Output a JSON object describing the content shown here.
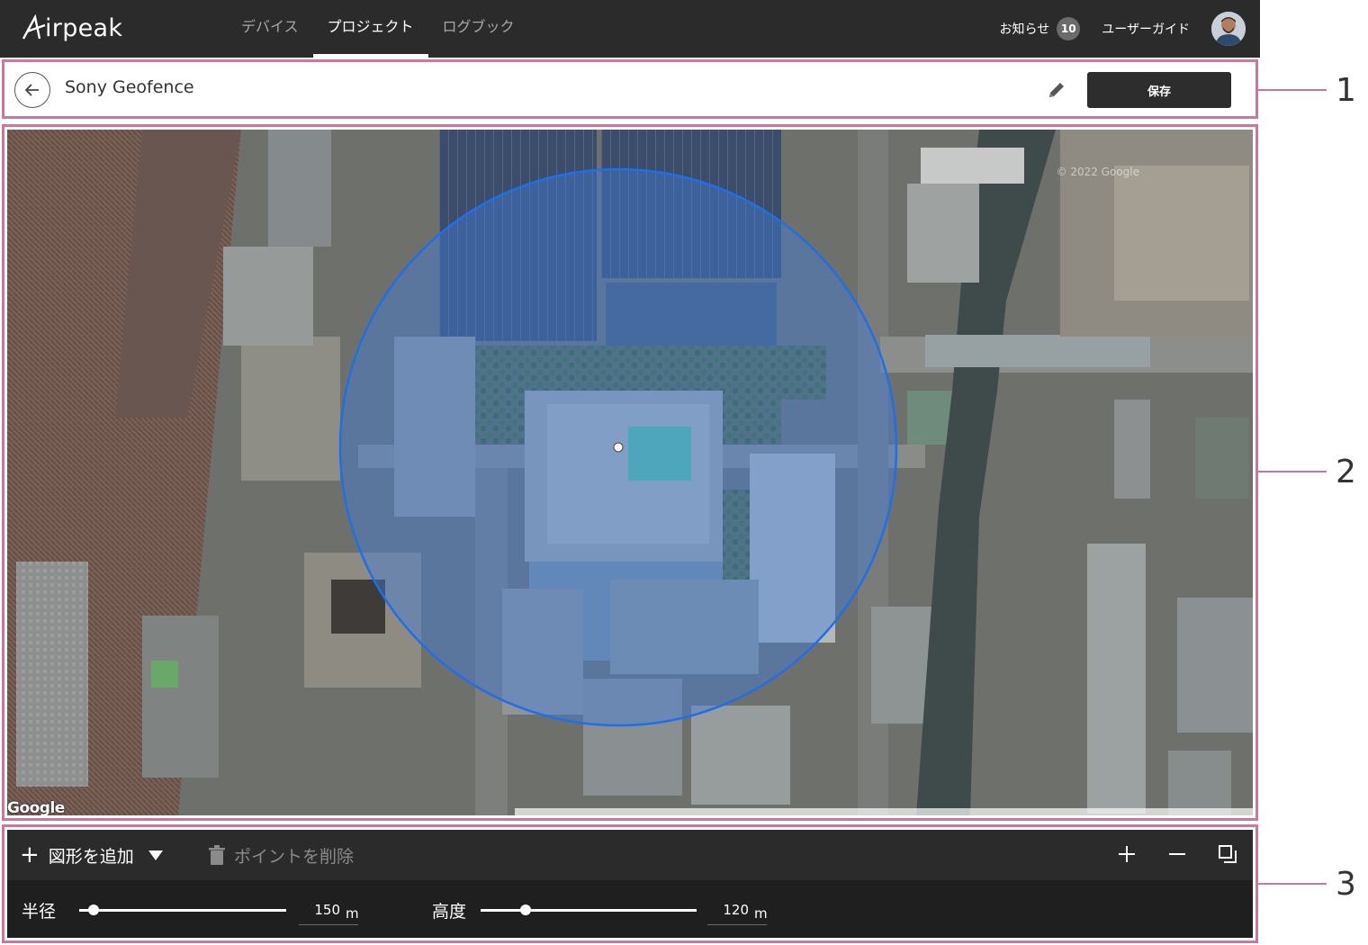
{
  "app": {
    "logo_text": "irpeak",
    "nav_tabs": [
      {
        "label": "デバイス",
        "active": false
      },
      {
        "label": "プロジェクト",
        "active": true
      },
      {
        "label": "ログブック",
        "active": false
      }
    ],
    "news_label": "お知らせ",
    "news_count": "10",
    "guide_label": "ユーザーガイド"
  },
  "header": {
    "title": "Sony Geofence",
    "save_label": "保存"
  },
  "map": {
    "provider_logo": "Google",
    "copyright": "© 2022 Google",
    "geofence": {
      "shape": "circle",
      "fill": "#3d7fe0",
      "stroke": "#1e6fe8"
    }
  },
  "toolbar": {
    "add_shape_label": "図形を追加",
    "delete_point_label": "ポイントを削除"
  },
  "sliders": {
    "radius": {
      "label": "半径",
      "value": "150",
      "unit": "m",
      "level": 0.07
    },
    "altitude": {
      "label": "高度",
      "value": "120",
      "unit": "m",
      "level": 0.21
    }
  },
  "callouts": [
    "1",
    "2",
    "3"
  ],
  "colors": {
    "topbar": "#2b2b2b",
    "accent_frame": "#c9779e",
    "save_button": "#2d2d2d"
  }
}
